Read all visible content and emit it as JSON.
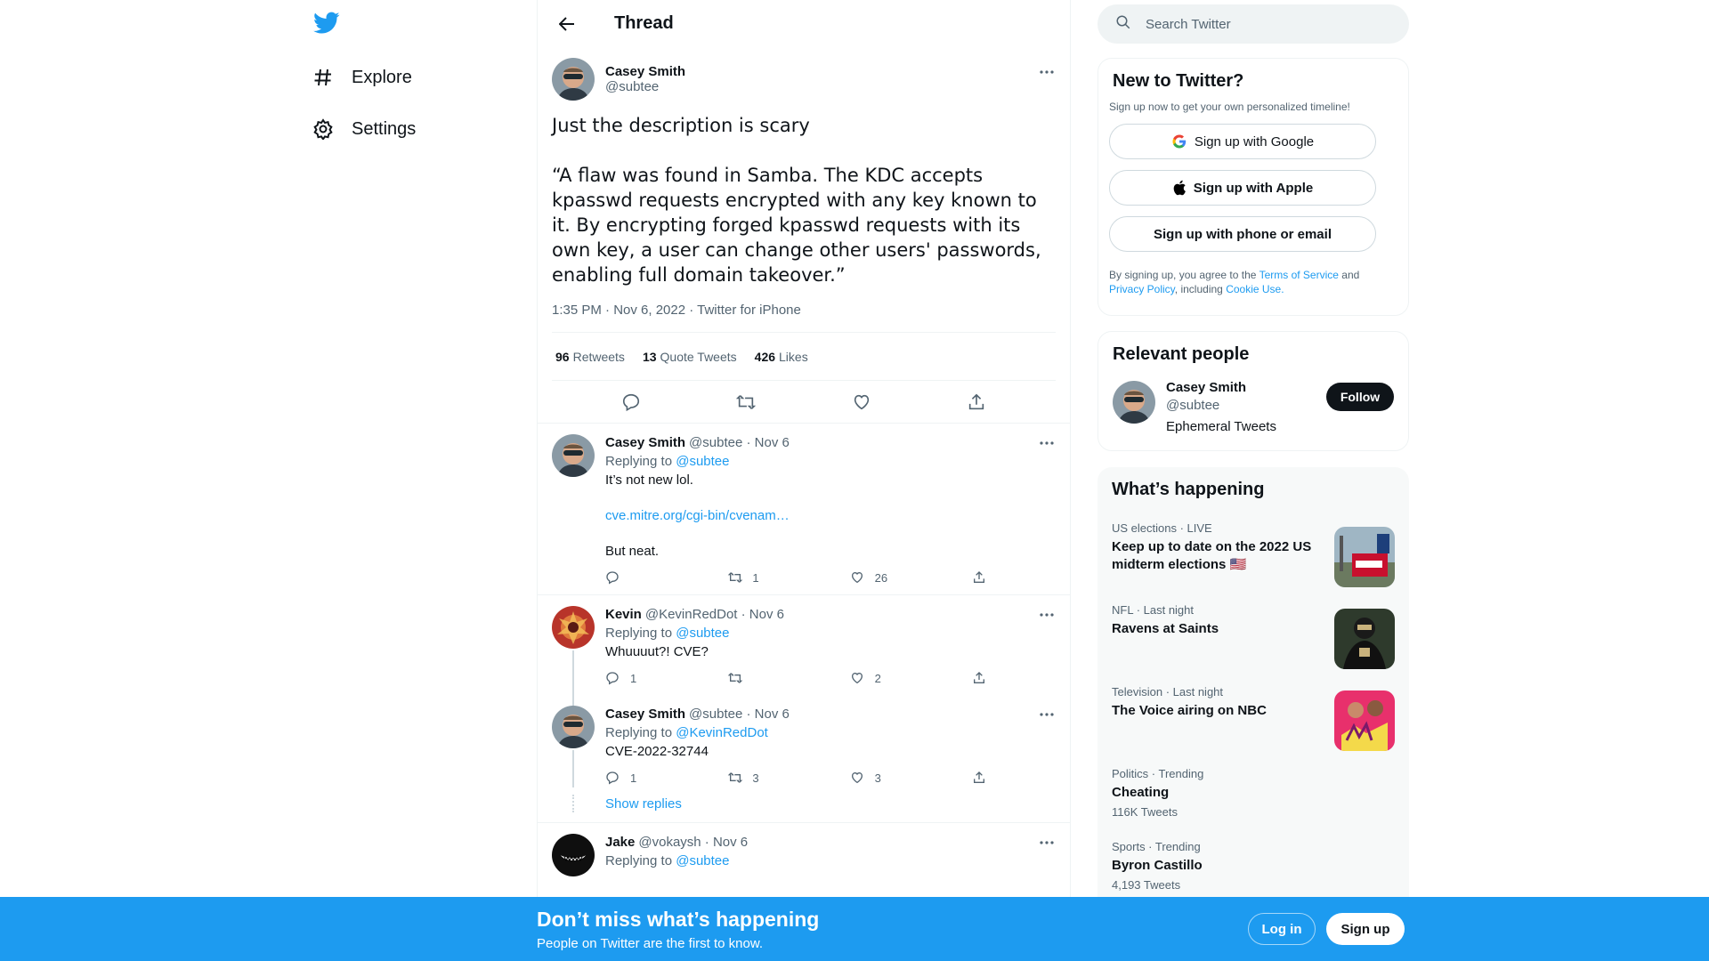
{
  "nav": {
    "explore_label": "Explore",
    "settings_label": "Settings"
  },
  "header": {
    "title": "Thread"
  },
  "focal_tweet": {
    "name": "Casey Smith",
    "handle": "@subtee",
    "text": "Just the description is scary\n\n“A flaw was found in Samba. The KDC accepts kpasswd requests encrypted with any key known to it. By encrypting forged kpasswd requests with its own key, a user can change other users' passwords, enabling full domain takeover.”",
    "meta": "1:35 PM · Nov 6, 2022 · Twitter for iPhone",
    "retweets_count": "96",
    "retweets_label": "Retweets",
    "quotes_count": "13",
    "quotes_label": "Quote Tweets",
    "likes_count": "426",
    "likes_label": "Likes"
  },
  "replies": [
    {
      "name": "Casey Smith",
      "handle_date": "@subtee · Nov 6",
      "replying_prefix": "Replying to",
      "replying_to": "@subtee",
      "line1": "It’s not new lol.",
      "link": "cve.mitre.org/cgi-bin/cvenam…",
      "line2": "But neat.",
      "reply_count": "",
      "retweet_count": "1",
      "like_count": "26"
    },
    {
      "name": "Kevin",
      "handle_date": "@KevinRedDot · Nov 6",
      "replying_prefix": "Replying to",
      "replying_to": "@subtee",
      "text": "Whuuuut?! CVE?",
      "reply_count": "1",
      "retweet_count": "",
      "like_count": "2"
    },
    {
      "name": "Casey Smith",
      "handle_date": "@subtee · Nov 6",
      "replying_prefix": "Replying to",
      "replying_to": "@KevinRedDot",
      "text": "CVE-2022-32744",
      "reply_count": "1",
      "retweet_count": "3",
      "like_count": "3"
    },
    {
      "name": "Jake",
      "handle_date": "@vokaysh · Nov 6",
      "replying_prefix": "Replying to",
      "replying_to": "@subtee"
    }
  ],
  "show_replies_label": "Show replies",
  "search": {
    "placeholder": "Search Twitter"
  },
  "new_to_twitter": {
    "title": "New to Twitter?",
    "subtitle": "Sign up now to get your own personalized timeline!",
    "google_label": "Sign up with Google",
    "apple_label": "Sign up with Apple",
    "phone_label": "Sign up with phone or email",
    "legal_prefix": "By signing up, you agree to the",
    "terms": "Terms of Service",
    "and": "and",
    "privacy": "Privacy Policy",
    "including": ", including",
    "cookie": "Cookie Use."
  },
  "relevant_people": {
    "title": "Relevant people",
    "name": "Casey Smith",
    "handle": "@subtee",
    "bio": "Ephemeral Tweets",
    "follow_label": "Follow"
  },
  "whats_happening": {
    "title": "What’s happening",
    "trends": [
      {
        "category": "US elections · LIVE",
        "title": "Keep up to date on the 2022 US midterm elections 🇺🇸"
      },
      {
        "category": "NFL · Last night",
        "title": "Ravens at Saints"
      },
      {
        "category": "Television · Last night",
        "title": "The Voice airing on NBC"
      },
      {
        "category": "Politics · Trending",
        "title": "Cheating",
        "count": "116K Tweets"
      },
      {
        "category": "Sports · Trending",
        "title": "Byron Castillo",
        "count": "4,193 Tweets"
      }
    ]
  },
  "bottom_bar": {
    "headline": "Don’t miss what’s happening",
    "subline": "People on Twitter are the first to know.",
    "login_label": "Log in",
    "signup_label": "Sign up"
  },
  "colors": {
    "accent": "#1d9bf0",
    "text": "#0f1419",
    "muted": "#536471"
  }
}
